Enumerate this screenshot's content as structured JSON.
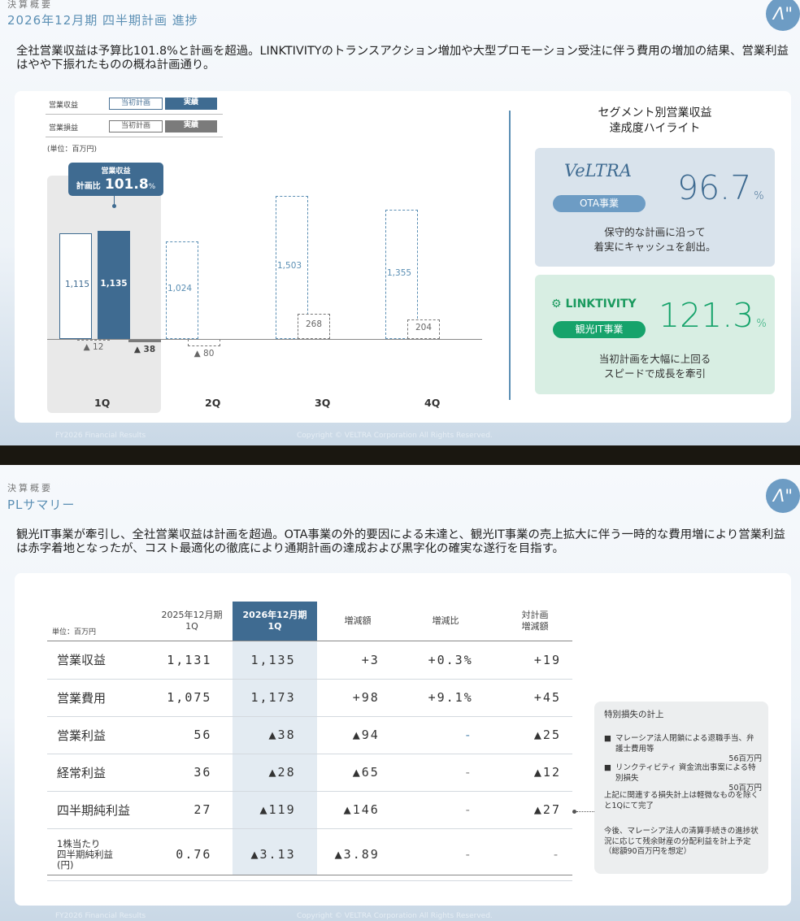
{
  "slide1": {
    "kicker": "決算概要",
    "title": "2026年12月期 四半期計画 進捗",
    "lead": "全社営業収益は予算比101.8%と計画を超過。LINKTIVITYのトランスアクション増加や大型プロモーション受注に伴う費用の増加の結果、営業利益はやや下振れたものの概ね計画通り。",
    "legend": {
      "revenue_label": "営業収益",
      "loss_label": "営業損益",
      "plan": "当初計画",
      "actual": "実績",
      "unit": "(単位：百万円)"
    },
    "callout": {
      "line1": "営業収益",
      "prefix": "計画比",
      "value": "101.8",
      "suffix": "%"
    },
    "chart_data": {
      "type": "bar",
      "categories": [
        "1Q",
        "2Q",
        "3Q",
        "4Q"
      ],
      "series": [
        {
          "name": "当初計画 営業収益",
          "values": [
            1115,
            1024,
            1503,
            1355
          ]
        },
        {
          "name": "実績 営業収益",
          "values": [
            1135,
            null,
            null,
            null
          ]
        },
        {
          "name": "当初計画 営業損益",
          "values": [
            -12,
            -80,
            268,
            204
          ]
        },
        {
          "name": "実績 営業損益",
          "values": [
            -38,
            null,
            null,
            null
          ]
        }
      ],
      "labels": {
        "plan_rev": [
          "1,115",
          "1,024",
          "1,503",
          "1,355"
        ],
        "actual_rev": "1,135",
        "plan_loss": [
          "▲ 12",
          "▲ 80",
          "268",
          "204"
        ],
        "actual_loss": "▲ 38"
      }
    },
    "highlight": {
      "title_line1": "セグメント別営業収益",
      "title_line2": "達成度ハイライト",
      "ota": {
        "brand": "VeLTRA",
        "pill": "OTA事業",
        "value": "96.7",
        "unit": "%",
        "desc1": "保守的な計画に沿って",
        "desc2": "着実にキャッシュを創出。"
      },
      "it": {
        "brand": "LINKTIVITY",
        "pill": "観光IT事業",
        "value": "121.3",
        "unit": "%",
        "desc1": "当初計画を大幅に上回る",
        "desc2": "スピードで成長を牽引"
      }
    },
    "footer_left": "FY2026 Financial Results",
    "footer_center": "Copyright © VELTRA Corporation All Rights Reserved."
  },
  "slide2": {
    "kicker": "決算概要",
    "title": "PLサマリー",
    "lead": "観光IT事業が牽引し、全社営業収益は計画を超過。OTA事業の外的要因による未達と、観光IT事業の売上拡大に伴う一時的な費用増により営業利益は赤字着地となったが、コスト最適化の徹底により通期計画の達成および黒字化の確実な遂行を目指す。",
    "unit": "単位：百万円",
    "headers": {
      "prev": "2025年12月期\n1Q",
      "curr": "2026年12月期\n1Q",
      "diff": "増減額",
      "rate": "増減比",
      "plan_diff": "対計画\n増減額"
    },
    "rows": [
      {
        "label": "営業収益",
        "prev": "1,131",
        "curr": "1,135",
        "diff": "+3",
        "rate": "+0.3%",
        "plan": "+19"
      },
      {
        "label": "営業費用",
        "prev": "1,075",
        "curr": "1,173",
        "diff": "+98",
        "rate": "+9.1%",
        "plan": "+45"
      },
      {
        "label": "営業利益",
        "prev": "56",
        "curr": "▲38",
        "diff": "▲94",
        "rate": "-",
        "plan": "▲25"
      },
      {
        "label": "経常利益",
        "prev": "36",
        "curr": "▲28",
        "diff": "▲65",
        "rate": "-",
        "plan": "▲12"
      },
      {
        "label": "四半期純利益",
        "prev": "27",
        "curr": "▲119",
        "diff": "▲146",
        "rate": "-",
        "plan": "▲27"
      },
      {
        "label": "1株当たり\n四半期純利益\n(円)",
        "prev": "0.76",
        "curr": "▲3.13",
        "diff": "▲3.89",
        "rate": "-",
        "plan": "-"
      }
    ],
    "note": {
      "title": "特別損失の計上",
      "item1": "マレーシア法人閉鎖による退職手当、弁護士費用等",
      "item1_val": "56百万円",
      "item2": "リンクティビティ 資金流出事案による特別損失",
      "item2_val": "50百万円",
      "para1": "上記に関連する損失計上は軽微なものを除くと1Qにて完了",
      "para2": "今後、マレーシア法人の清算手続きの進捗状況に応じて残余財産の分配利益を計上予定（総額90百万円を想定）"
    },
    "footer_left": "FY2026 Financial Results",
    "footer_center": "Copyright © VELTRA Corporation All Rights Reserved."
  }
}
